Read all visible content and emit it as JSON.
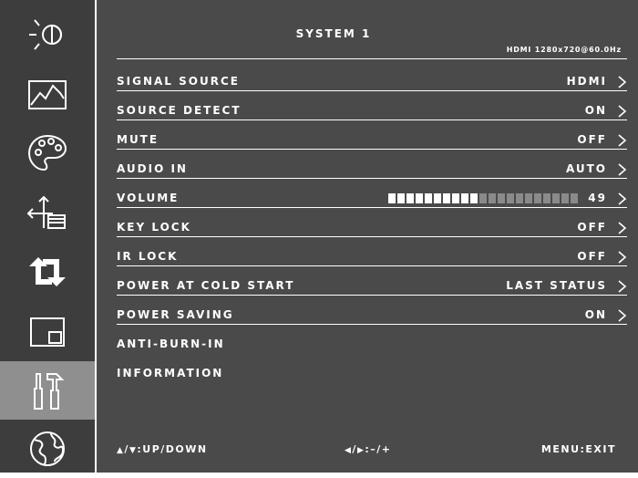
{
  "menu": {
    "title": "SYSTEM 1",
    "signal_info": "HDMI 1280x720@60.0Hz"
  },
  "sidebar": {
    "items": [
      {
        "icon": "brightness-icon",
        "selected": false
      },
      {
        "icon": "picture-icon",
        "selected": false
      },
      {
        "icon": "palette-icon",
        "selected": false
      },
      {
        "icon": "position-icon",
        "selected": false
      },
      {
        "icon": "swap-icon",
        "selected": false
      },
      {
        "icon": "pip-icon",
        "selected": false
      },
      {
        "icon": "tools-icon",
        "selected": true
      },
      {
        "icon": "globe-icon",
        "selected": false
      }
    ]
  },
  "rows": {
    "signal_source": {
      "label": "SIGNAL SOURCE",
      "value": "HDMI"
    },
    "source_detect": {
      "label": "SOURCE DETECT",
      "value": "ON"
    },
    "mute": {
      "label": "MUTE",
      "value": "OFF"
    },
    "audio_in": {
      "label": "AUDIO IN",
      "value": "AUTO"
    },
    "volume": {
      "label": "VOLUME",
      "value": "49",
      "level": 0.49
    },
    "key_lock": {
      "label": "KEY LOCK",
      "value": "OFF"
    },
    "ir_lock": {
      "label": "IR LOCK",
      "value": "OFF"
    },
    "power_cold_start": {
      "label": "POWER AT COLD START",
      "value": "LAST STATUS"
    },
    "power_saving": {
      "label": "POWER SAVING",
      "value": "ON"
    },
    "anti_burn_in": {
      "label": "ANTI-BURN-IN"
    },
    "information": {
      "label": "INFORMATION"
    }
  },
  "footer": {
    "updown": "UP/DOWN",
    "adjust": "–/+",
    "exit": "MENU:EXIT"
  },
  "colors": {
    "background": "#4a4a4a",
    "sidebar": "#3d3d3d",
    "selected": "#8f8f8f",
    "volume_filled": "#ffffff",
    "volume_empty": "#8a8a8a"
  }
}
